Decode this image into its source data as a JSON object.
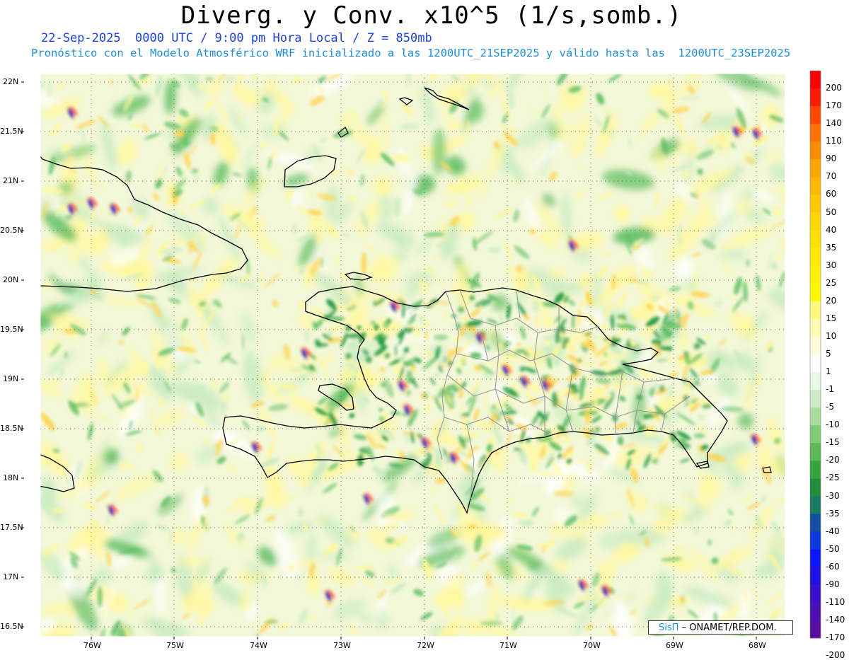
{
  "title": "Diverg. y Conv. x10^5 (1/s,somb.)",
  "subtitle_line1": "22-Sep-2025  0000 UTC / 9:00 pm Hora Local / Z = 850mb",
  "subtitle_line2": "Pronóstico con el Modelo Atmosférico WRF inicializado a las 1200UTC_21SEP2025 y válido hasta las  1200UTC_23SEP2025",
  "lat_labels": [
    "22N",
    "21.5N",
    "21N",
    "20.5N",
    "20N",
    "19.5N",
    "19N",
    "18.5N",
    "18N",
    "17.5N",
    "17N",
    "16.5N"
  ],
  "lon_labels": [
    "76W",
    "75W",
    "74W",
    "73W",
    "72W",
    "71W",
    "70W",
    "69W",
    "68W"
  ],
  "colorbar": {
    "labels": [
      "200",
      "170",
      "140",
      "110",
      "90",
      "70",
      "60",
      "50",
      "40",
      "35",
      "30",
      "25",
      "20",
      "15",
      "10",
      "5",
      "1",
      "-1",
      "-5",
      "-10",
      "-15",
      "-20",
      "-25",
      "-30",
      "-35",
      "-40",
      "-50",
      "-60",
      "-90",
      "-110",
      "-140",
      "-170",
      "-200"
    ],
    "colors": [
      "#ff0000",
      "#ff1a00",
      "#ff4500",
      "#ff7000",
      "#ff8c00",
      "#ffa500",
      "#ffb800",
      "#ffc800",
      "#ffd700",
      "#ffe100",
      "#ffeb00",
      "#fff200",
      "#fff700",
      "#fffb7a",
      "#fffdb3",
      "#fffed8",
      "#ffffff",
      "#eaf6e6",
      "#cdebc6",
      "#a8dd9e",
      "#80cc76",
      "#5ab956",
      "#33a53c",
      "#1d8f3a",
      "#1a7a5e",
      "#124fa0",
      "#0a3ae0",
      "#0a18ff",
      "#2010e6",
      "#3a10cc",
      "#4a10b3",
      "#560f9e"
    ]
  },
  "map_palette": {
    "sea": "#f3f8d8",
    "land": "#f4f3c8",
    "yellow": "#fff79a",
    "orange": "#ffd24a",
    "red": "#ff4d1a",
    "lightgreen": "#c9ebc2",
    "green": "#5fbf63",
    "darkgreen": "#1f9a40",
    "blue": "#0a3ae0",
    "darkblue": "#1a1aa0"
  },
  "credit": {
    "logo": "SisΠ",
    "text": "– ONAMET/REP.DOM."
  }
}
